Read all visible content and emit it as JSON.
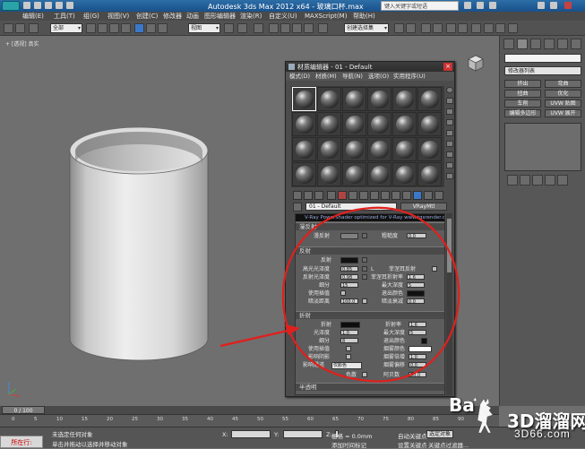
{
  "app": {
    "title": "Autodesk 3ds Max  2012 x64 - 玻璃口杯.max",
    "search_placeholder": "键入关键字或短语",
    "brand_color": "#2aa2a8"
  },
  "menu": [
    "编辑(E)",
    "工具(T)",
    "组(G)",
    "视图(V)",
    "创建(C)",
    "修改器",
    "动画",
    "图形编辑器",
    "渲染(R)",
    "自定义(U)",
    "MAXScript(M)",
    "帮助(H)"
  ],
  "toolbar": {
    "filter_select": "全部",
    "ref_coord_select": "视图",
    "named_sel_select": "创建选择集"
  },
  "viewport": {
    "label": "+ [透视] 真实",
    "bg_color": "#6f6f6f"
  },
  "material_editor": {
    "title": "材质编辑器 - 01 - Default",
    "menu": [
      "模式(D)",
      "材质(M)",
      "导航(N)",
      "选项(O)",
      "实用程序(U)"
    ],
    "material_name": "01 - Default",
    "material_type": "VRayMtl",
    "banner": "V-Ray PowerShader  optimized for V-Ray  www.tgsrender.com",
    "rollouts": {
      "diffuse": "漫反射",
      "reflection": "反射",
      "refraction": "折射",
      "translucency": "半透明"
    },
    "diffuse": {
      "roughness_label": "粗糙度",
      "roughness": "0.0",
      "diffuse_label": "漫反射",
      "map_btn": "M"
    },
    "reflection": {
      "reflect_label": "反射",
      "hilight_gloss_label": "高光光泽度",
      "hilight_gloss": "0.85",
      "refl_gloss_label": "反射光泽度",
      "refl_gloss": "0.98",
      "subdivs_label": "细分",
      "subdivs": "15",
      "use_interp_label": "使用插值",
      "dim_dist_label": "暗淡距离",
      "dim_dist": "100.0",
      "fresnel_label": "菲涅耳反射",
      "fresnel_ior_label": "菲涅耳折射率",
      "fresnel_ior": "1.6",
      "max_depth_label": "最大深度",
      "max_depth": "5",
      "exit_color_label": "退出颜色",
      "dim_falloff_label": "暗淡衰减",
      "dim_falloff": "0.0",
      "lock_label": "L"
    },
    "refraction": {
      "refract_label": "折射",
      "ior_label": "折射率",
      "ior": "1.6",
      "gloss_label": "光泽度",
      "gloss": "1.0",
      "max_depth_label": "最大深度",
      "max_depth": "5",
      "subdivs_label": "细分",
      "subdivs": "8",
      "exit_color_label": "退出颜色",
      "use_interp_label": "使用插值",
      "fog_color_label": "烟雾颜色",
      "affect_shadows_label": "影响阴影",
      "fog_mult_label": "烟雾倍增",
      "fog_mult": "1.0",
      "affect_channels_label": "影响通道",
      "affect_channels": "仅颜色",
      "fog_bias_label": "烟雾偏移",
      "fog_bias": "0.0",
      "dispersion_label": "色散",
      "abbe_label": "阿贝数",
      "abbe": "50.0"
    }
  },
  "command_panel": {
    "modifier_list": "修改器列表",
    "buttons": [
      "挤出",
      "弯曲",
      "扭曲",
      "优化",
      "车削",
      "UVW 贴图",
      "编辑多边形",
      "UVW 展开"
    ]
  },
  "timeline": {
    "frame": "0 / 100",
    "ticks": [
      "0",
      "5",
      "10",
      "15",
      "20",
      "25",
      "30",
      "35",
      "40",
      "45",
      "50",
      "55",
      "60",
      "65",
      "70",
      "75",
      "80",
      "85",
      "90"
    ]
  },
  "status": {
    "welcome": "所在行:",
    "line1": "未选定任何对象",
    "line2": "单击并拖动以选择并移动对象",
    "x_label": "X:",
    "y_label": "Y:",
    "z_label": "Z:",
    "grid": "栅格 = 0.0mm",
    "add_time_tag": "添加时间标记",
    "auto_key": "自动关键点",
    "set_key": "设置关键点",
    "selected": "选定对象",
    "key_filters": "关键点过滤器..."
  },
  "watermark": {
    "site_cn": "3D溜溜网",
    "site_url": "3D66.com",
    "bai_text": "Ba"
  },
  "annotation_color": "#e0201d"
}
